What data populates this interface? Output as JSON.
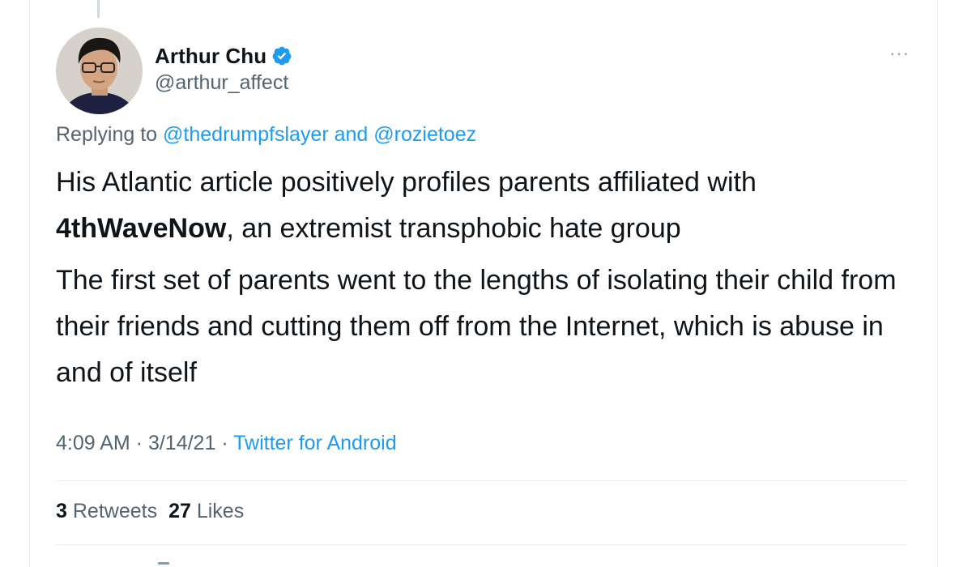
{
  "author": {
    "display_name": "Arthur Chu",
    "handle": "@arthur_affect",
    "verified": true,
    "verified_icon": "verified-badge-icon",
    "avatar_icon": "avatar-photo"
  },
  "more_menu": {
    "label": "···",
    "icon": "more-options-icon"
  },
  "reply_context": {
    "prefix": "Replying to ",
    "mention_1": "@thedrumpfslayer",
    "joiner": " and ",
    "mention_2": "@rozietoez"
  },
  "tweet": {
    "para1_part1": "His Atlantic article positively profiles parents affiliated with ",
    "para1_bold": "4thWaveNow",
    "para1_part2": ", an extremist transphobic hate group",
    "para2": "The first set of parents went to the lengths of isolating their child from their friends and cutting them off from the Internet, which is abuse in and of itself"
  },
  "meta": {
    "time": "4:09 AM",
    "sep1": " · ",
    "date": "3/14/21",
    "sep2": " · ",
    "source": "Twitter for Android"
  },
  "stats": {
    "retweets_count": "3",
    "retweets_label": "Retweets",
    "likes_count": "27",
    "likes_label": "Likes"
  },
  "colors": {
    "link": "#1d9bf0",
    "secondary_text": "#536471",
    "primary_text": "#0f1419",
    "divider": "#e6ecf0"
  }
}
